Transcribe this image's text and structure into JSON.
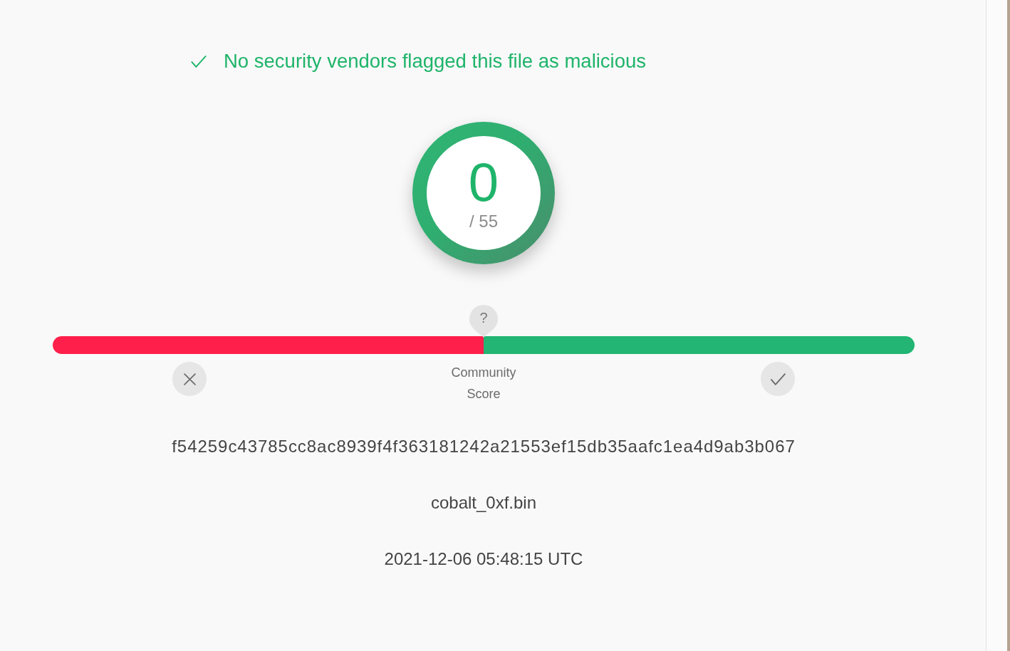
{
  "detection": {
    "message": "No security vendors flagged this file as malicious",
    "malicious_count": "0",
    "total": "/ 55"
  },
  "community_score": {
    "marker": "?",
    "level": 0.5,
    "label": "Community Score"
  },
  "file": {
    "hash": "f54259c43785cc8ac8939f4f363181242a21553ef15db35aafc1ea4d9ab3b067",
    "name": "cobalt_0xf.bin",
    "date": "2021-12-06 05:48:15 UTC"
  }
}
